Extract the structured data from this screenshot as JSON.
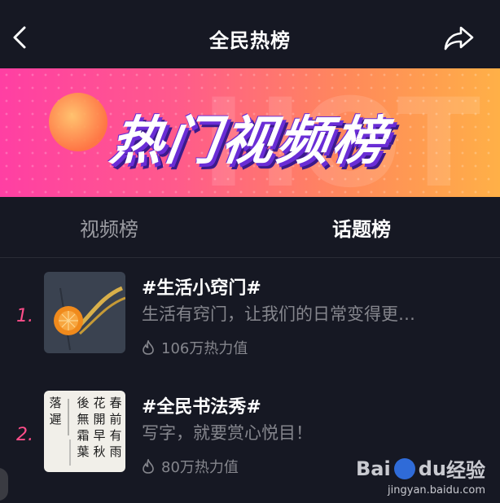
{
  "header": {
    "title": "全民热榜"
  },
  "banner": {
    "title": "热门视频榜",
    "ghost_text": "HOT"
  },
  "tabs": [
    {
      "label": "视频榜",
      "active": false
    },
    {
      "label": "话题榜",
      "active": true
    }
  ],
  "topics": [
    {
      "rank": "1.",
      "name": "#生活小窍门#",
      "description": "生活有窍门，让我们的日常变得更…",
      "heat": "106万热力值"
    },
    {
      "rank": "2.",
      "name": "#全民书法秀#",
      "description": "写字，就要赏心悦目！",
      "heat": "80万热力值"
    }
  ],
  "calligraphy_text": [
    "春",
    "前",
    "有",
    "雨",
    "花",
    "開",
    "早",
    "秋",
    "後",
    "無",
    "霜",
    "葉",
    "落",
    "遲"
  ],
  "watermark": {
    "brand_left": "Bai",
    "brand_mid": "du",
    "brand_right": "经验",
    "url": "jingyan.baidu.com"
  },
  "colors": {
    "background": "#161823",
    "accent": "#ff4e8a",
    "muted": "#85868d"
  }
}
